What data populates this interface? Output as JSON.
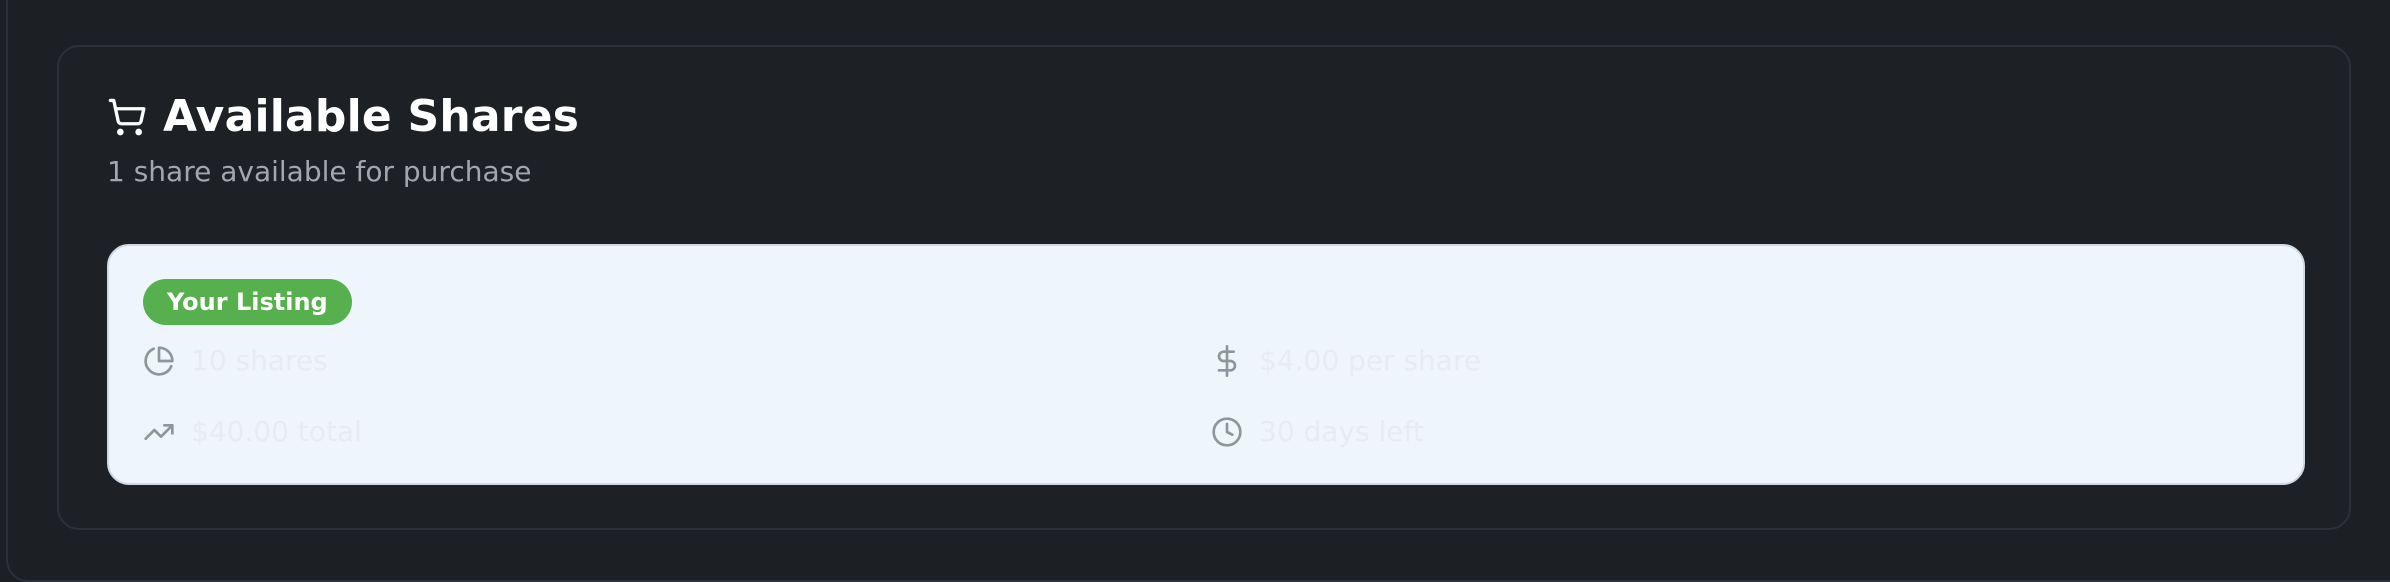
{
  "card": {
    "title": "Available Shares",
    "subtitle": "1 share available for purchase"
  },
  "listing": {
    "badge": "Your Listing",
    "shares": "10 shares",
    "price_per_share": "$4.00 per share",
    "total": "$40.00 total",
    "time_left": "30 days left"
  },
  "icons": {
    "header": "shopping-cart-icon",
    "shares": "pie-chart-icon",
    "price": "dollar-sign-icon",
    "total": "trending-up-icon",
    "time": "clock-icon"
  },
  "colors": {
    "background": "#1c1f24",
    "badge": "#56b04d",
    "listing_bg": "#eef5fd"
  }
}
